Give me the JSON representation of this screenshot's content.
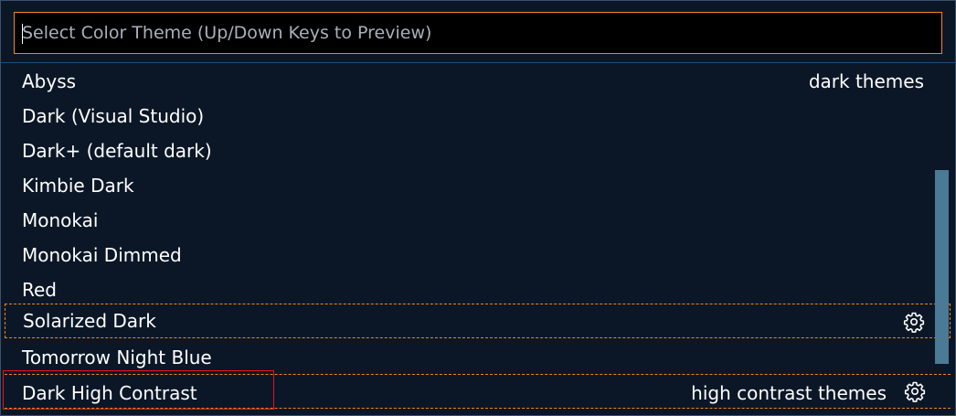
{
  "window": {
    "border_color": "#39506c",
    "background": "#0b1727"
  },
  "search": {
    "placeholder": "Select Color Theme (Up/Down Keys to Preview)",
    "value": "",
    "border_color": "#f38518"
  },
  "themes": [
    {
      "label": "Abyss",
      "group": "dark themes"
    },
    {
      "label": "Dark (Visual Studio)"
    },
    {
      "label": "Dark+ (default dark)"
    },
    {
      "label": "Kimbie Dark"
    },
    {
      "label": "Monokai"
    },
    {
      "label": "Monokai Dimmed"
    },
    {
      "label": "Red"
    },
    {
      "label": "Solarized Dark",
      "focused": true,
      "icon": "gear-icon"
    },
    {
      "label": "Tomorrow Night Blue"
    },
    {
      "label": "Dark High Contrast",
      "group": "high contrast themes",
      "icon": "gear-icon",
      "annotated": true
    }
  ],
  "colors": {
    "focus_outline": "#f38518",
    "scrollbar_thumb": "#4a7a96",
    "annotation_box": "#e81123",
    "text": "#ffffff"
  }
}
